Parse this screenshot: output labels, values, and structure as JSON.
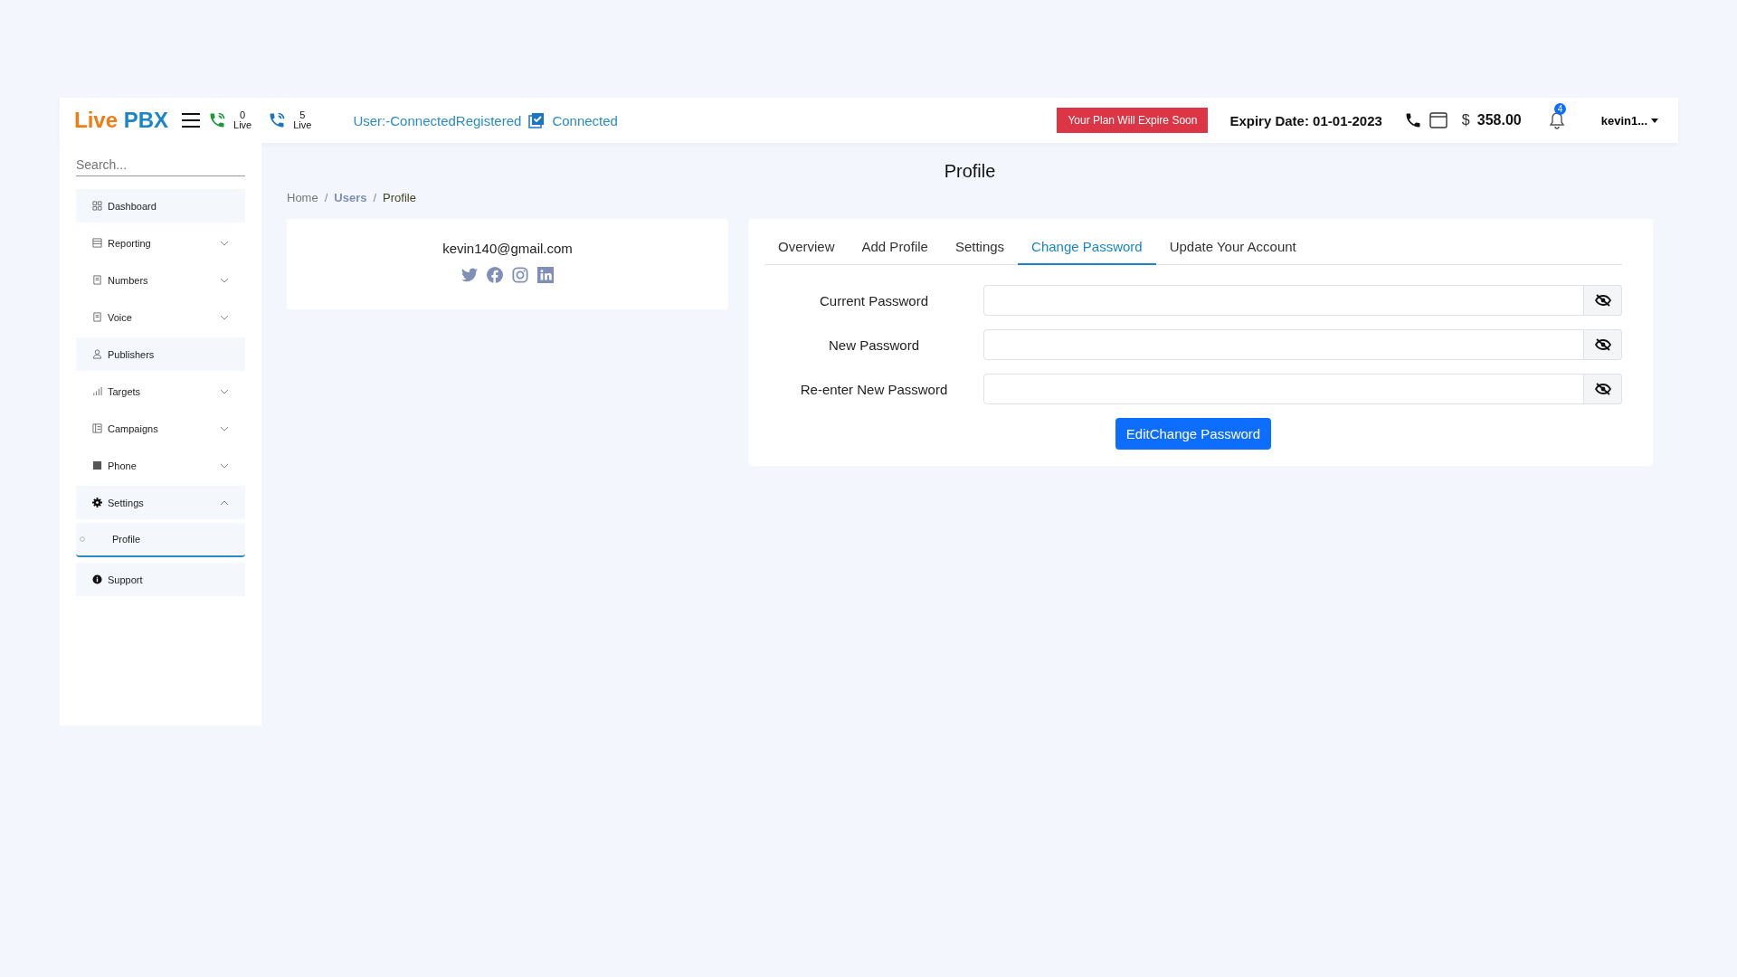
{
  "header": {
    "logo": {
      "part_1": "Live",
      "part_2": "PBX"
    },
    "counters": [
      {
        "count": "0",
        "label": "Live"
      },
      {
        "count": "5",
        "label": "Live"
      }
    ],
    "status": "User:-ConnectedRegistered",
    "connection": "Connected",
    "plan_button": "Your Plan Will Expire Soon",
    "expiry": "Expiry Date: 01-01-2023",
    "currency": "$",
    "balance": "358.00",
    "notifications": "4",
    "user": "kevin1..."
  },
  "sidebar": {
    "search": {
      "placeholder": "Search..."
    },
    "items": [
      {
        "label": "Dashboard"
      },
      {
        "label": "Reporting",
        "expanded": false
      },
      {
        "label": "Numbers",
        "expanded": false
      },
      {
        "label": "Voice",
        "expanded": false
      },
      {
        "label": "Publishers"
      },
      {
        "label": "Targets",
        "expanded": false
      },
      {
        "label": "Campaigns",
        "expanded": false
      },
      {
        "label": "Phone",
        "expanded": false
      },
      {
        "label": "Settings",
        "expanded": true,
        "children": [
          {
            "label": "Profile",
            "selected": true
          }
        ]
      },
      {
        "label": "Support"
      }
    ]
  },
  "page_title": "Profile",
  "breadcrumb": {
    "separator": "/",
    "items": [
      "Home",
      "Users",
      "Profile"
    ]
  },
  "profile_card": {
    "email": "kevin140@gmail.com"
  },
  "tabs": [
    {
      "label": "Overview",
      "selected": false
    },
    {
      "label": "Add Profile",
      "selected": false
    },
    {
      "label": "Settings",
      "selected": false
    },
    {
      "label": "Change Password",
      "selected": true
    },
    {
      "label": "Update Your Account",
      "selected": false
    }
  ],
  "form": {
    "fields": [
      {
        "label": "Current Password"
      },
      {
        "label": "New Password"
      },
      {
        "label": "Re-enter New Password"
      }
    ],
    "submit": "EditChange Password"
  }
}
